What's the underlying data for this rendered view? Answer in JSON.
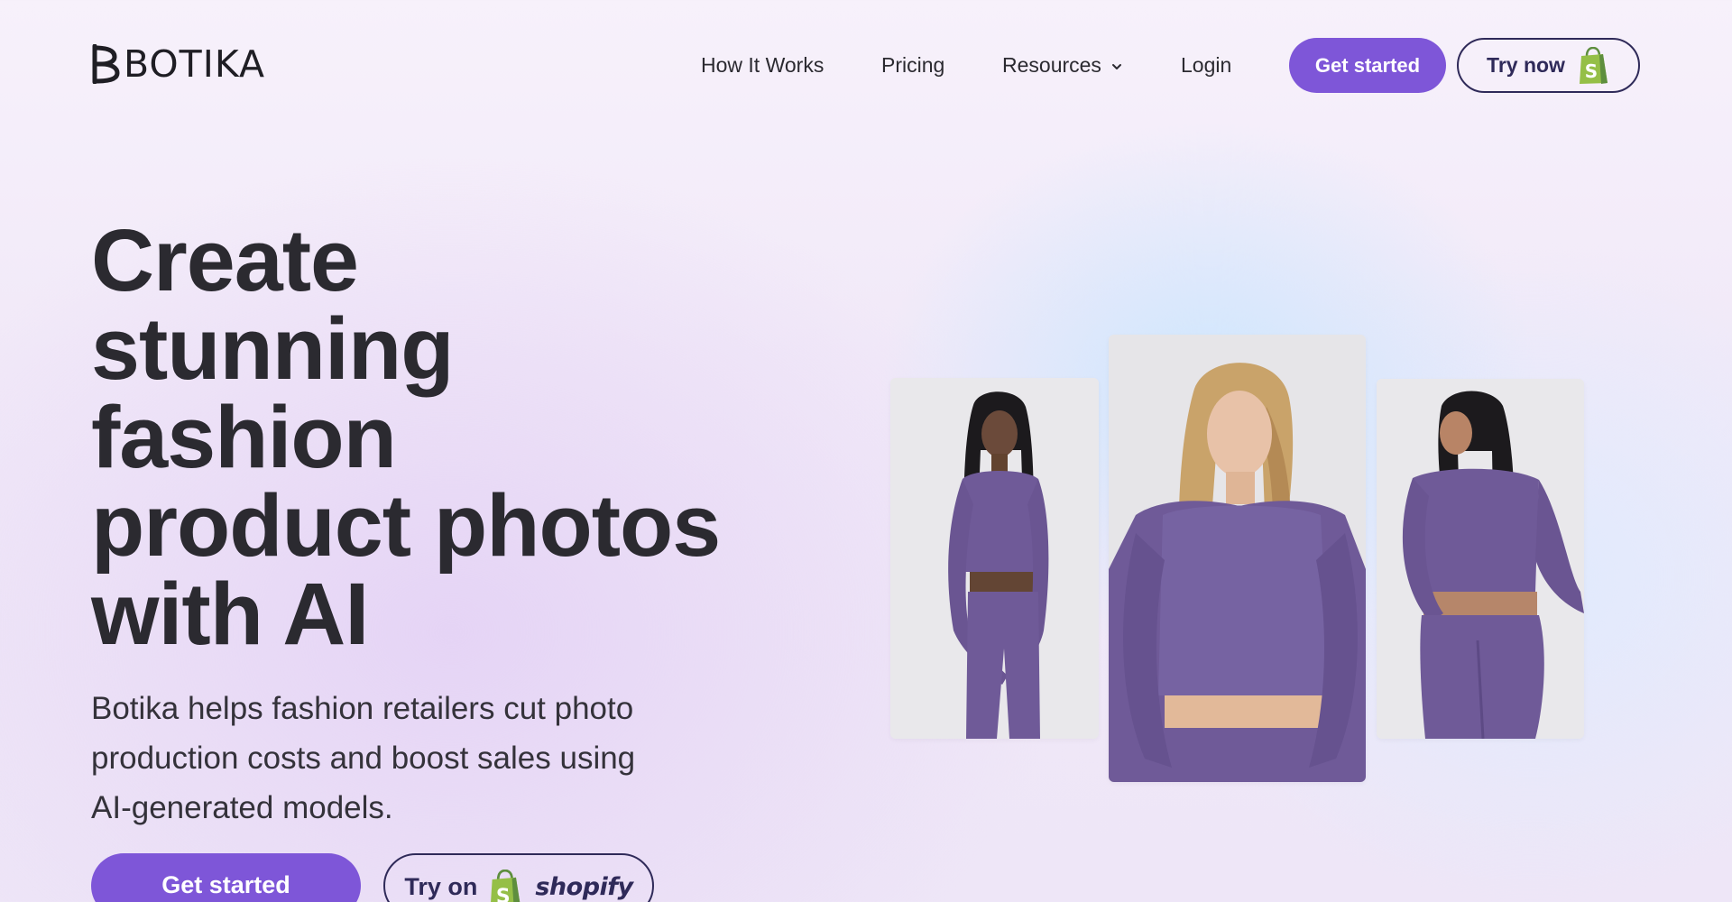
{
  "brand": {
    "name": "BOTIKA",
    "logo_icon": "botika-b-logo-icon"
  },
  "nav": {
    "how_it_works": "How It Works",
    "pricing": "Pricing",
    "resources": "Resources",
    "login": "Login",
    "get_started": "Get started",
    "try_now": "Try now"
  },
  "hero": {
    "title_lines": [
      "Create",
      "stunning",
      "fashion",
      "product photos",
      "with AI"
    ],
    "subtitle": "Botika helps fashion retailers cut photo production costs and boost sales using AI-generated models.",
    "cta_primary": "Get started",
    "cta_secondary_prefix": "Try on",
    "cta_secondary_brand": "shopify"
  },
  "photos": [
    {
      "icon": "model-photo-front-icon"
    },
    {
      "icon": "model-photo-closeup-icon"
    },
    {
      "icon": "model-photo-back-icon"
    }
  ],
  "colors": {
    "accent": "#7e56d8",
    "outline": "#2f2a59",
    "text": "#2b2a30",
    "shopify_green": "#95bf47",
    "outfit_purple": "#6f5a98"
  }
}
